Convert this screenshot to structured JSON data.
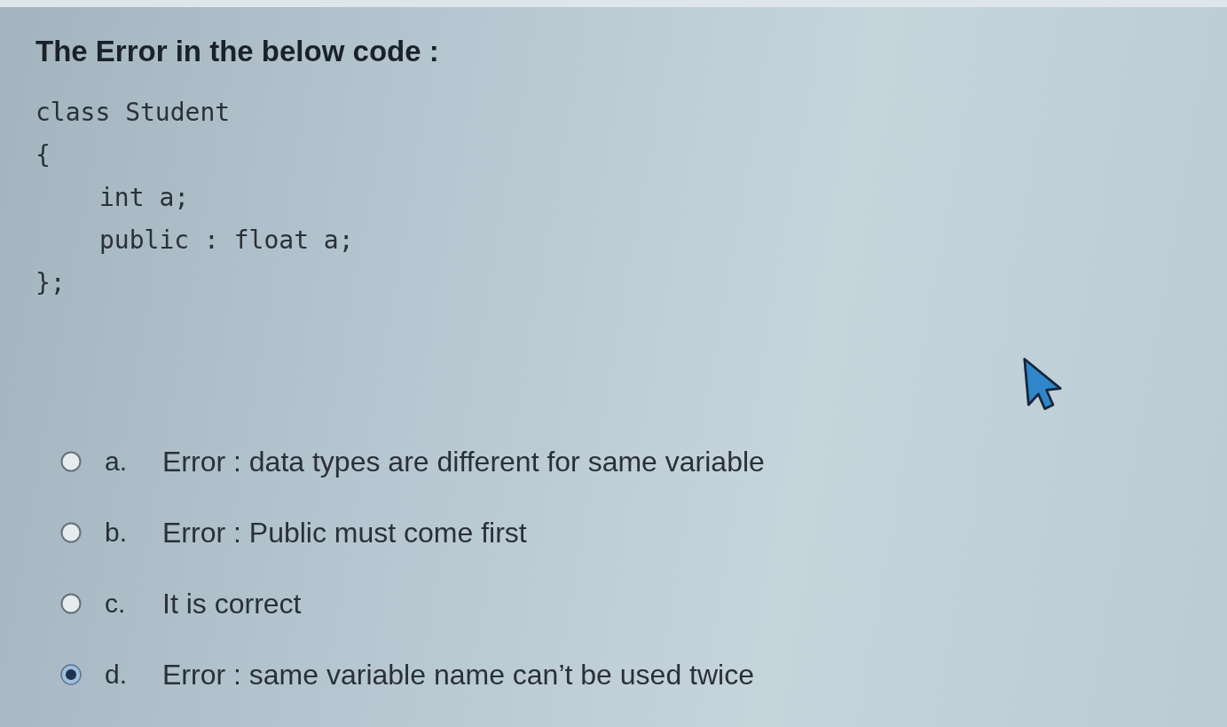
{
  "question": {
    "title": "The Error in the below code :",
    "code": [
      {
        "kind": "plain",
        "text": "class Student"
      },
      {
        "kind": "plain",
        "text": "{"
      },
      {
        "kind": "statement",
        "text": "int a;"
      },
      {
        "kind": "statement",
        "text": "public : float a;"
      },
      {
        "kind": "plain",
        "text": "};"
      }
    ]
  },
  "options": [
    {
      "letter": "a.",
      "text": "Error : data types are different for same variable",
      "selected": false
    },
    {
      "letter": "b.",
      "text": "Error : Public must come first",
      "selected": false
    },
    {
      "letter": "c.",
      "text": "It is correct",
      "selected": false
    },
    {
      "letter": "d.",
      "text": "Error : same variable name can’t be used twice",
      "selected": true
    }
  ]
}
